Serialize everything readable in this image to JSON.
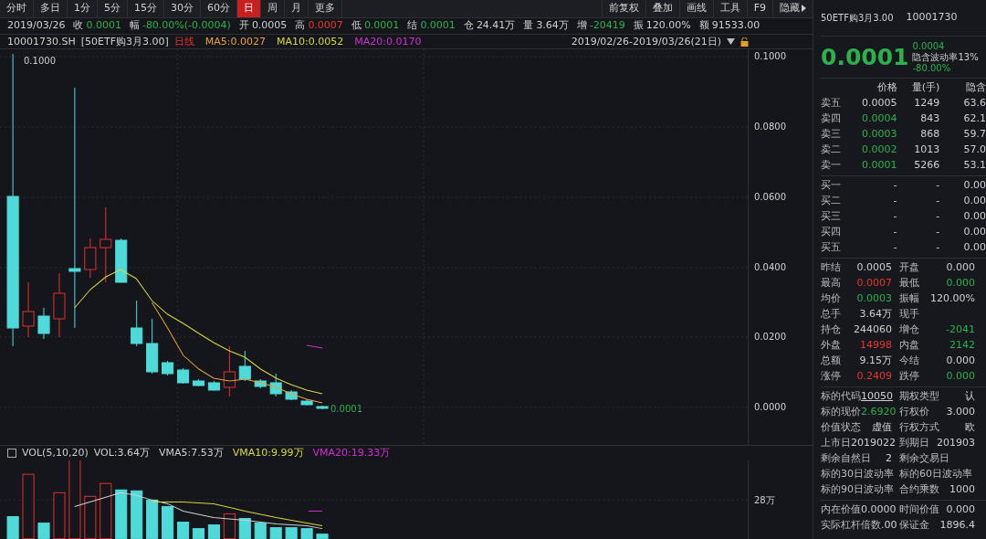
{
  "toolbar": {
    "periods": [
      {
        "label": "分时",
        "selected": false
      },
      {
        "label": "多日",
        "selected": false
      },
      {
        "label": "1分",
        "selected": false
      },
      {
        "label": "5分",
        "selected": false
      },
      {
        "label": "15分",
        "selected": false
      },
      {
        "label": "30分",
        "selected": false
      },
      {
        "label": "60分",
        "selected": false
      },
      {
        "label": "日",
        "selected": true
      },
      {
        "label": "周",
        "selected": false
      },
      {
        "label": "月",
        "selected": false
      },
      {
        "label": "更多",
        "selected": false
      }
    ],
    "tools": [
      "前复权",
      "叠加",
      "画线",
      "工具",
      "F9",
      "隐藏"
    ]
  },
  "quote_bar": {
    "date": "2019/03/26",
    "items": [
      {
        "label": "收",
        "value": "0.0001",
        "color": "#2bb24c"
      },
      {
        "label": "幅",
        "value": "-80.00%(-0.0004)",
        "color": "#2bb24c"
      },
      {
        "label": "开",
        "value": "0.0005",
        "color": "#cfcfcf"
      },
      {
        "label": "高",
        "value": "0.0007",
        "color": "#e5372d"
      },
      {
        "label": "低",
        "value": "0.0001",
        "color": "#2bb24c"
      },
      {
        "label": "结",
        "value": "0.0001",
        "color": "#2bb24c"
      },
      {
        "label": "仓",
        "value": "24.41万",
        "color": "#cfcfcf"
      },
      {
        "label": "量",
        "value": "3.64万",
        "color": "#cfcfcf"
      },
      {
        "label": "增",
        "value": "-20419",
        "color": "#2bb24c"
      },
      {
        "label": "振",
        "value": "120.00%",
        "color": "#cfcfcf"
      },
      {
        "label": "额",
        "value": "91533.00",
        "color": "#cfcfcf"
      }
    ]
  },
  "chart_header": {
    "symbol": "10001730.SH",
    "name": "[50ETF购3月3.00]",
    "indicators": [
      {
        "label": "日线",
        "color": "#e0302f"
      },
      {
        "label": "MA5:0.0027",
        "color": "#e8a33a"
      },
      {
        "label": "MA10:0.0052",
        "color": "#d8d83a"
      },
      {
        "label": "MA20:0.0170",
        "color": "#d22fd2"
      }
    ],
    "range": "2019/02/26-2019/03/26(21日)"
  },
  "price_axis": [
    "0.1000",
    "0.0800",
    "0.0600",
    "0.0400",
    "0.0200",
    "0.0000"
  ],
  "high_label": "0.1000",
  "last_label": "0.0001",
  "volume_header": {
    "title": "VOL(5,10,20)",
    "indicators": [
      {
        "label": "VOL:3.64万",
        "color": "#d0d0d0"
      },
      {
        "label": "VMA5:7.53万",
        "color": "#d0d0d0"
      },
      {
        "label": "VMA10:9.99万",
        "color": "#d8d83a"
      },
      {
        "label": "VMA20:19.33万",
        "color": "#d22fd2"
      }
    ]
  },
  "volume_axis": "28万",
  "right_panel": {
    "title": "50ETF购3月3.00",
    "code": "10001730",
    "price": {
      "text": "0.0001",
      "color": "#2bb24c"
    },
    "side_lines": [
      {
        "text": "0.0004",
        "color": "#2bb24c"
      },
      {
        "text": "隐含波动率13%",
        "color": "#cfcfcf"
      },
      {
        "text": "-80.00%",
        "color": "#2bb24c"
      }
    ],
    "book_header": [
      "价格",
      "量(手)",
      "隐含"
    ],
    "asks": [
      {
        "label": "卖五",
        "price": "0.0005",
        "color": "#cfcfcf",
        "volume": "1249",
        "iv": "63.6"
      },
      {
        "label": "卖四",
        "price": "0.0004",
        "color": "#2bb24c",
        "volume": "843",
        "iv": "62.1"
      },
      {
        "label": "卖三",
        "price": "0.0003",
        "color": "#2bb24c",
        "volume": "868",
        "iv": "59.7"
      },
      {
        "label": "卖二",
        "price": "0.0002",
        "color": "#2bb24c",
        "volume": "1013",
        "iv": "57.0"
      },
      {
        "label": "卖一",
        "price": "0.0001",
        "color": "#2bb24c",
        "volume": "5266",
        "iv": "53.1"
      }
    ],
    "bids": [
      {
        "label": "买一",
        "price": "-",
        "volume": "-",
        "iv": "0.00"
      },
      {
        "label": "买二",
        "price": "-",
        "volume": "-",
        "iv": "0.00"
      },
      {
        "label": "买三",
        "price": "-",
        "volume": "-",
        "iv": "0.00"
      },
      {
        "label": "买四",
        "price": "-",
        "volume": "-",
        "iv": "0.00"
      },
      {
        "label": "买五",
        "price": "-",
        "volume": "-",
        "iv": "0.00"
      }
    ],
    "stats": [
      [
        {
          "label": "昨结",
          "value": "0.0005",
          "color": "#cfcfcf"
        },
        {
          "label": "开盘",
          "value": "0.000",
          "color": "#cfcfcf"
        }
      ],
      [
        {
          "label": "最高",
          "value": "0.0007",
          "color": "#e5372d"
        },
        {
          "label": "最低",
          "value": "0.000",
          "color": "#2bb24c"
        }
      ],
      [
        {
          "label": "均价",
          "value": "0.0003",
          "color": "#2bb24c"
        },
        {
          "label": "振幅",
          "value": "120.00%",
          "color": "#cfcfcf"
        }
      ],
      [
        {
          "label": "总手",
          "value": "3.64万",
          "color": "#cfcfcf"
        },
        {
          "label": "现手"
        }
      ],
      [
        {
          "label": "持仓",
          "value": "244060",
          "color": "#cfcfcf"
        },
        {
          "label": "增仓",
          "value": "-2041",
          "color": "#2bb24c"
        }
      ],
      [
        {
          "label": "外盘",
          "value": "14998",
          "color": "#e5372d"
        },
        {
          "label": "内盘",
          "value": "2142",
          "color": "#2bb24c"
        }
      ],
      [
        {
          "label": "总额",
          "value": "9.15万",
          "color": "#cfcfcf"
        },
        {
          "label": "今结",
          "value": "0.000",
          "color": "#cfcfcf"
        }
      ],
      [
        {
          "label": "涨停",
          "value": "0.2409",
          "color": "#e5372d"
        },
        {
          "label": "跌停",
          "value": "0.000",
          "color": "#2bb24c"
        }
      ]
    ],
    "details": [
      [
        {
          "label": "标的代码",
          "value": "10050",
          "color": "#cfcfcf",
          "link": true
        },
        {
          "label": "期权类型",
          "value": "认"
        }
      ],
      [
        {
          "label": "标的现价",
          "value": "2.6920",
          "color": "#2bb24c"
        },
        {
          "label": "行权价",
          "value": "3.000",
          "color": "#cfcfcf"
        }
      ],
      [
        {
          "label": "价值状态",
          "value": "虚值"
        },
        {
          "label": "行权方式",
          "value": "欧",
          "color": "#cfcfcf"
        }
      ],
      [
        {
          "label": "上市日",
          "value": "2019022",
          "color": "#cfcfcf"
        },
        {
          "label": "到期日",
          "value": "201903",
          "color": "#cfcfcf"
        }
      ],
      [
        {
          "label": "剩余自然日",
          "value": "2",
          "color": "#cfcfcf"
        },
        {
          "label": "剩余交易日"
        }
      ],
      [
        {
          "label": "标的30日波动率"
        },
        {
          "label": "标的60日波动率"
        }
      ],
      [
        {
          "label": "标的90日波动率"
        },
        {
          "label": "合约乘数",
          "value": "1000",
          "color": "#cfcfcf"
        }
      ]
    ],
    "values": [
      [
        {
          "label": "内在价值",
          "value": "0.0000",
          "color": "#cfcfcf"
        },
        {
          "label": "时间价值",
          "value": "0.000",
          "color": "#cfcfcf"
        }
      ],
      [
        {
          "label": "实际杠杆倍数",
          "value": ".00"
        },
        {
          "label": "保证金",
          "value": "1896.4",
          "color": "#cfcfcf"
        }
      ]
    ]
  }
}
